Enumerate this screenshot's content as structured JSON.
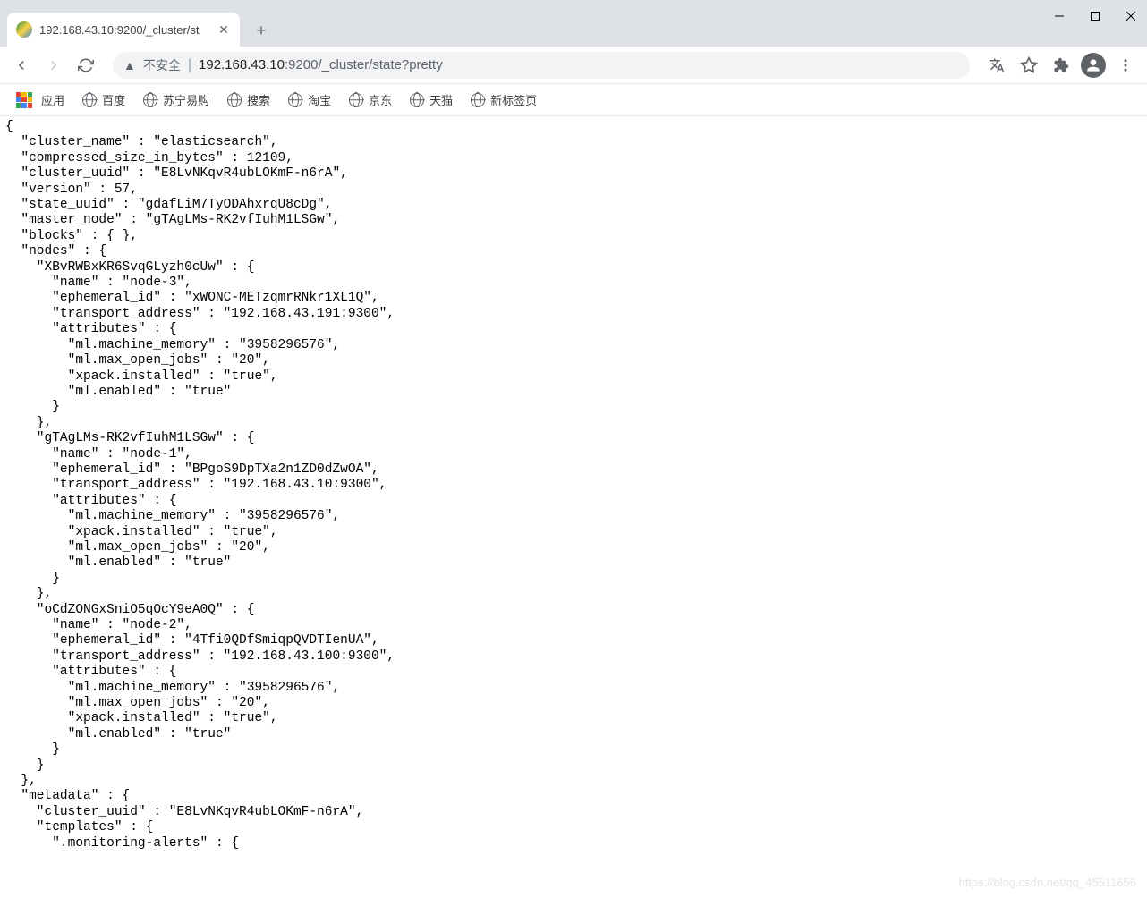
{
  "tab": {
    "title": "192.168.43.10:9200/_cluster/st"
  },
  "address": {
    "insecure_label": "不安全",
    "host": "192.168.43.10",
    "port_path": ":9200/_cluster/state?pretty"
  },
  "bookmarks": {
    "apps": "应用",
    "items": [
      "百度",
      "苏宁易购",
      "搜索",
      "淘宝",
      "京东",
      "天猫",
      "新标签页"
    ]
  },
  "json_body": "{\n  \"cluster_name\" : \"elasticsearch\",\n  \"compressed_size_in_bytes\" : 12109,\n  \"cluster_uuid\" : \"E8LvNKqvR4ubLOKmF-n6rA\",\n  \"version\" : 57,\n  \"state_uuid\" : \"gdafLiM7TyODAhxrqU8cDg\",\n  \"master_node\" : \"gTAgLMs-RK2vfIuhM1LSGw\",\n  \"blocks\" : { },\n  \"nodes\" : {\n    \"XBvRWBxKR6SvqGLyzh0cUw\" : {\n      \"name\" : \"node-3\",\n      \"ephemeral_id\" : \"xWONC-METzqmrRNkr1XL1Q\",\n      \"transport_address\" : \"192.168.43.191:9300\",\n      \"attributes\" : {\n        \"ml.machine_memory\" : \"3958296576\",\n        \"ml.max_open_jobs\" : \"20\",\n        \"xpack.installed\" : \"true\",\n        \"ml.enabled\" : \"true\"\n      }\n    },\n    \"gTAgLMs-RK2vfIuhM1LSGw\" : {\n      \"name\" : \"node-1\",\n      \"ephemeral_id\" : \"BPgoS9DpTXa2n1ZD0dZwOA\",\n      \"transport_address\" : \"192.168.43.10:9300\",\n      \"attributes\" : {\n        \"ml.machine_memory\" : \"3958296576\",\n        \"xpack.installed\" : \"true\",\n        \"ml.max_open_jobs\" : \"20\",\n        \"ml.enabled\" : \"true\"\n      }\n    },\n    \"oCdZONGxSniO5qOcY9eA0Q\" : {\n      \"name\" : \"node-2\",\n      \"ephemeral_id\" : \"4Tfi0QDfSmiqpQVDTIenUA\",\n      \"transport_address\" : \"192.168.43.100:9300\",\n      \"attributes\" : {\n        \"ml.machine_memory\" : \"3958296576\",\n        \"ml.max_open_jobs\" : \"20\",\n        \"xpack.installed\" : \"true\",\n        \"ml.enabled\" : \"true\"\n      }\n    }\n  },\n  \"metadata\" : {\n    \"cluster_uuid\" : \"E8LvNKqvR4ubLOKmF-n6rA\",\n    \"templates\" : {\n      \".monitoring-alerts\" : {",
  "watermark": "https://blog.csdn.net/qq_45511656"
}
